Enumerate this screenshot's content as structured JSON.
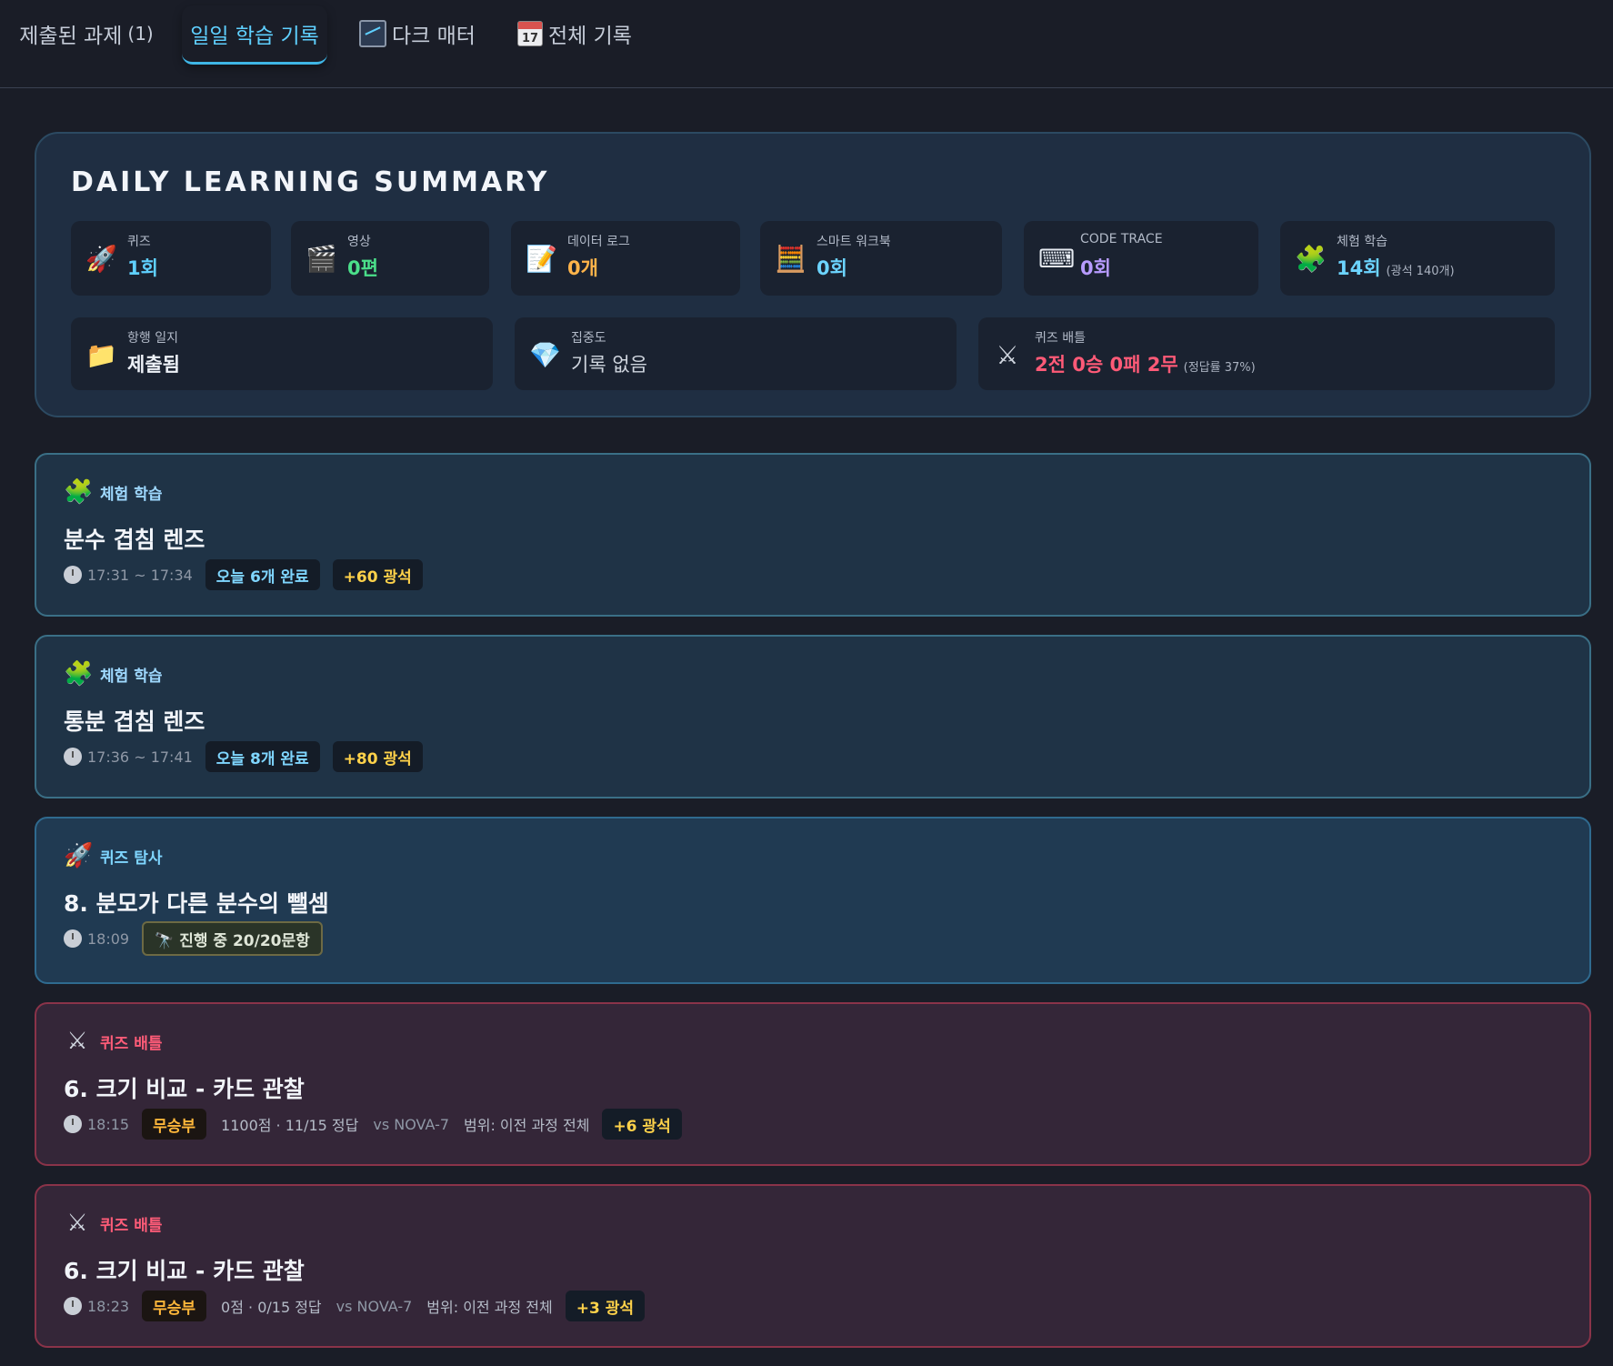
{
  "tabs": [
    {
      "label": "제출된 과제",
      "count": "(1)",
      "icon": ""
    },
    {
      "label": "일일 학습 기록",
      "count": "",
      "icon": "",
      "active": true
    },
    {
      "label": "다크 매터",
      "count": "",
      "icon": "chart-icon"
    },
    {
      "label": "전체 기록",
      "count": "",
      "icon": "calendar-icon",
      "icon_text": "17"
    }
  ],
  "summary": {
    "title": "DAILY LEARNING SUMMARY",
    "row1": [
      {
        "icon": "rocket-icon",
        "label": "퀴즈",
        "value": "1회",
        "color": "#5fd0ff"
      },
      {
        "icon": "clapper-icon",
        "label": "영상",
        "value": "0편",
        "color": "#4be08a"
      },
      {
        "icon": "memo-icon",
        "label": "데이터 로그",
        "value": "0개",
        "color": "#ffb44a"
      },
      {
        "icon": "abacus-icon",
        "label": "스마트 워크북",
        "value": "0회",
        "color": "#6cd4ff"
      },
      {
        "icon": "keyboard-icon",
        "label": "CODE TRACE",
        "value": "0회",
        "color": "#b79bff"
      },
      {
        "icon": "puzzle-icon",
        "label": "체험 학습",
        "value": "14회",
        "sub": "(광석 140개)",
        "color": "#6cd4ff"
      }
    ],
    "row2": [
      {
        "icon": "folder-icon",
        "label": "항행 일지",
        "value": "제출됨",
        "color": "#eef2f8"
      },
      {
        "icon": "gem-icon",
        "label": "집중도",
        "value": "기록 없음",
        "color": "#cfd5de"
      },
      {
        "icon": "swords-icon",
        "label": "퀴즈 배틀",
        "value": "2전 0승 0패 2무",
        "sub": "(정답률 37%)",
        "color": "#ff5a77"
      }
    ]
  },
  "records": [
    {
      "type": "exp",
      "category": "체험 학습",
      "title": "분수 겹침 렌즈",
      "time": "17:31 ~ 17:34",
      "badges": [
        {
          "text": "오늘 6개 완료",
          "kind": "blue"
        },
        {
          "text": "+60 광석",
          "kind": "gold"
        }
      ]
    },
    {
      "type": "exp",
      "category": "체험 학습",
      "title": "통분 겹침 렌즈",
      "time": "17:36 ~ 17:41",
      "badges": [
        {
          "text": "오늘 8개 완료",
          "kind": "blue"
        },
        {
          "text": "+80 광석",
          "kind": "gold"
        }
      ]
    },
    {
      "type": "quiz",
      "category": "퀴즈 탐사",
      "title": "8. 분모가 다른 분수의 뺄셈",
      "time": "18:09",
      "badges": [
        {
          "text": "🔭 진행 중 20/20문항",
          "kind": "progress"
        }
      ]
    },
    {
      "type": "battle",
      "category": "퀴즈 배틀",
      "title": "6. 크기 비교 - 카드 관찰",
      "time": "18:15",
      "result": "무승부",
      "score": "1100점 · 11/15 정답",
      "opponent": "vs NOVA-7",
      "scope": "범위: 이전 과정 전체",
      "reward": "+6 광석"
    },
    {
      "type": "battle",
      "category": "퀴즈 배틀",
      "title": "6. 크기 비교 - 카드 관찰",
      "time": "18:23",
      "result": "무승부",
      "score": "0점 · 0/15 정답",
      "opponent": "vs NOVA-7",
      "scope": "범위: 이전 과정 전체",
      "reward": "+3 광석"
    }
  ]
}
